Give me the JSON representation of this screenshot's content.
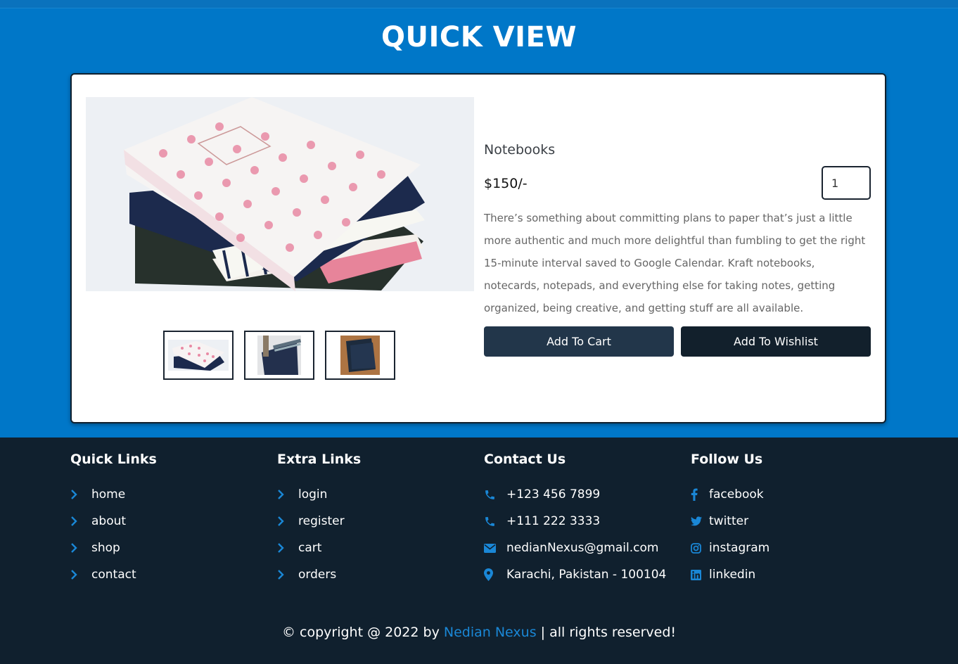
{
  "quick_view": {
    "title": "QUICK VIEW",
    "product": {
      "name": "Notebooks",
      "price": "$150/-",
      "quantity": "1",
      "description": "There’s something about committing plans to paper that’s just a little more authentic and much more delightful than fumbling to get the right 15-minute interval saved to Google Calendar. Kraft notebooks, notecards, notepads, and everything else for taking notes, getting organized, being creative, and getting stuff are all available.",
      "add_to_cart": "Add To Cart",
      "add_to_wishlist": "Add To Wishlist"
    }
  },
  "footer": {
    "quick_links": {
      "title": "Quick Links",
      "items": [
        "home",
        "about",
        "shop",
        "contact"
      ]
    },
    "extra_links": {
      "title": "Extra Links",
      "items": [
        "login",
        "register",
        "cart",
        "orders"
      ]
    },
    "contact": {
      "title": "Contact Us",
      "items": [
        "+123 456 7899",
        "+111 222 3333",
        "nedianNexus@gmail.com",
        "Karachi, Pakistan - 100104"
      ]
    },
    "follow": {
      "title": "Follow Us",
      "items": [
        "facebook",
        "twitter",
        "instagram",
        "linkedin"
      ]
    },
    "copyright": {
      "prefix": "© copyright @ 2022 by",
      "brand": "Nedian Nexus",
      "suffix": "| all rights reserved!"
    }
  },
  "colors": {
    "accent": "#0077c8",
    "dark": "#10202e",
    "brand_link": "#1a87d6"
  }
}
